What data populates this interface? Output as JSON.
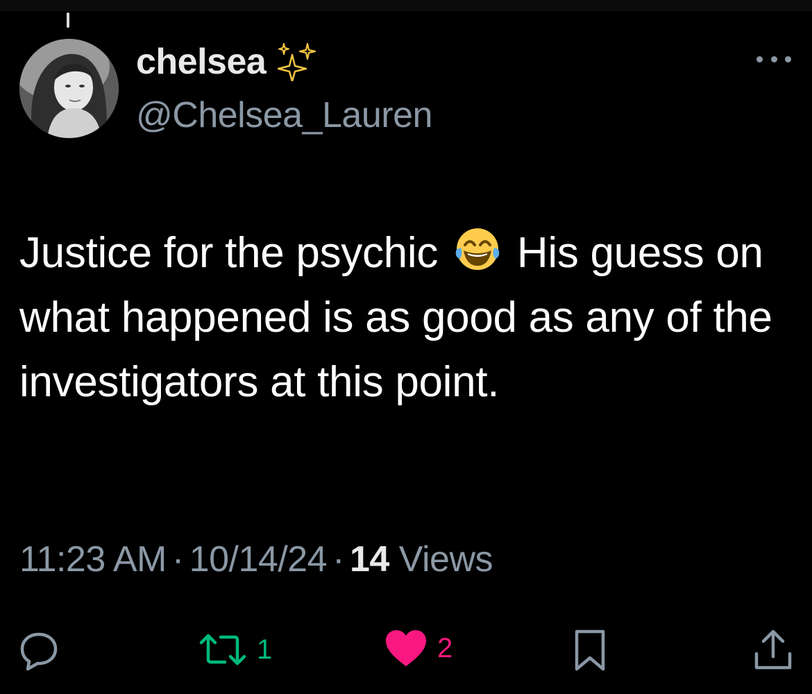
{
  "tweet": {
    "display_name": "chelsea",
    "handle": "@Chelsea_Lauren",
    "text_before_emoji": "Justice for the psychic ",
    "text_after_emoji": " His guess on what happened is as good as any of the investigators at this point.",
    "emoji": "face-with-tears-of-joy"
  },
  "meta": {
    "time": "11:23 AM",
    "separator": "·",
    "date": "10/14/24",
    "views_count": "14",
    "views_label": "Views"
  },
  "actions": {
    "retweet_count": "1",
    "like_count": "2"
  },
  "colors": {
    "background": "#000000",
    "secondary_text": "#8b98a5",
    "retweet_green": "#00ba7c",
    "like_pink": "#f91880",
    "emoji_yellow": "#ffcc4d"
  },
  "icons": [
    "sparkles-icon",
    "more-options-icon",
    "reply-icon",
    "retweet-icon",
    "heart-icon",
    "bookmark-icon",
    "share-icon"
  ]
}
